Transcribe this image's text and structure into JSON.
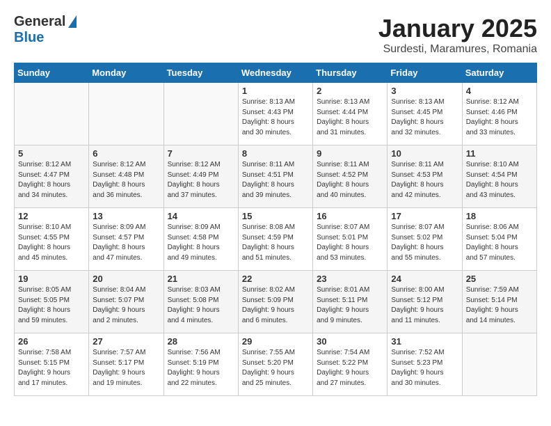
{
  "logo": {
    "general": "General",
    "blue": "Blue"
  },
  "title": "January 2025",
  "location": "Surdesti, Maramures, Romania",
  "days_of_week": [
    "Sunday",
    "Monday",
    "Tuesday",
    "Wednesday",
    "Thursday",
    "Friday",
    "Saturday"
  ],
  "weeks": [
    [
      {
        "day": "",
        "info": ""
      },
      {
        "day": "",
        "info": ""
      },
      {
        "day": "",
        "info": ""
      },
      {
        "day": "1",
        "info": "Sunrise: 8:13 AM\nSunset: 4:43 PM\nDaylight: 8 hours\nand 30 minutes."
      },
      {
        "day": "2",
        "info": "Sunrise: 8:13 AM\nSunset: 4:44 PM\nDaylight: 8 hours\nand 31 minutes."
      },
      {
        "day": "3",
        "info": "Sunrise: 8:13 AM\nSunset: 4:45 PM\nDaylight: 8 hours\nand 32 minutes."
      },
      {
        "day": "4",
        "info": "Sunrise: 8:12 AM\nSunset: 4:46 PM\nDaylight: 8 hours\nand 33 minutes."
      }
    ],
    [
      {
        "day": "5",
        "info": "Sunrise: 8:12 AM\nSunset: 4:47 PM\nDaylight: 8 hours\nand 34 minutes."
      },
      {
        "day": "6",
        "info": "Sunrise: 8:12 AM\nSunset: 4:48 PM\nDaylight: 8 hours\nand 36 minutes."
      },
      {
        "day": "7",
        "info": "Sunrise: 8:12 AM\nSunset: 4:49 PM\nDaylight: 8 hours\nand 37 minutes."
      },
      {
        "day": "8",
        "info": "Sunrise: 8:11 AM\nSunset: 4:51 PM\nDaylight: 8 hours\nand 39 minutes."
      },
      {
        "day": "9",
        "info": "Sunrise: 8:11 AM\nSunset: 4:52 PM\nDaylight: 8 hours\nand 40 minutes."
      },
      {
        "day": "10",
        "info": "Sunrise: 8:11 AM\nSunset: 4:53 PM\nDaylight: 8 hours\nand 42 minutes."
      },
      {
        "day": "11",
        "info": "Sunrise: 8:10 AM\nSunset: 4:54 PM\nDaylight: 8 hours\nand 43 minutes."
      }
    ],
    [
      {
        "day": "12",
        "info": "Sunrise: 8:10 AM\nSunset: 4:55 PM\nDaylight: 8 hours\nand 45 minutes."
      },
      {
        "day": "13",
        "info": "Sunrise: 8:09 AM\nSunset: 4:57 PM\nDaylight: 8 hours\nand 47 minutes."
      },
      {
        "day": "14",
        "info": "Sunrise: 8:09 AM\nSunset: 4:58 PM\nDaylight: 8 hours\nand 49 minutes."
      },
      {
        "day": "15",
        "info": "Sunrise: 8:08 AM\nSunset: 4:59 PM\nDaylight: 8 hours\nand 51 minutes."
      },
      {
        "day": "16",
        "info": "Sunrise: 8:07 AM\nSunset: 5:01 PM\nDaylight: 8 hours\nand 53 minutes."
      },
      {
        "day": "17",
        "info": "Sunrise: 8:07 AM\nSunset: 5:02 PM\nDaylight: 8 hours\nand 55 minutes."
      },
      {
        "day": "18",
        "info": "Sunrise: 8:06 AM\nSunset: 5:04 PM\nDaylight: 8 hours\nand 57 minutes."
      }
    ],
    [
      {
        "day": "19",
        "info": "Sunrise: 8:05 AM\nSunset: 5:05 PM\nDaylight: 8 hours\nand 59 minutes."
      },
      {
        "day": "20",
        "info": "Sunrise: 8:04 AM\nSunset: 5:07 PM\nDaylight: 9 hours\nand 2 minutes."
      },
      {
        "day": "21",
        "info": "Sunrise: 8:03 AM\nSunset: 5:08 PM\nDaylight: 9 hours\nand 4 minutes."
      },
      {
        "day": "22",
        "info": "Sunrise: 8:02 AM\nSunset: 5:09 PM\nDaylight: 9 hours\nand 6 minutes."
      },
      {
        "day": "23",
        "info": "Sunrise: 8:01 AM\nSunset: 5:11 PM\nDaylight: 9 hours\nand 9 minutes."
      },
      {
        "day": "24",
        "info": "Sunrise: 8:00 AM\nSunset: 5:12 PM\nDaylight: 9 hours\nand 11 minutes."
      },
      {
        "day": "25",
        "info": "Sunrise: 7:59 AM\nSunset: 5:14 PM\nDaylight: 9 hours\nand 14 minutes."
      }
    ],
    [
      {
        "day": "26",
        "info": "Sunrise: 7:58 AM\nSunset: 5:15 PM\nDaylight: 9 hours\nand 17 minutes."
      },
      {
        "day": "27",
        "info": "Sunrise: 7:57 AM\nSunset: 5:17 PM\nDaylight: 9 hours\nand 19 minutes."
      },
      {
        "day": "28",
        "info": "Sunrise: 7:56 AM\nSunset: 5:19 PM\nDaylight: 9 hours\nand 22 minutes."
      },
      {
        "day": "29",
        "info": "Sunrise: 7:55 AM\nSunset: 5:20 PM\nDaylight: 9 hours\nand 25 minutes."
      },
      {
        "day": "30",
        "info": "Sunrise: 7:54 AM\nSunset: 5:22 PM\nDaylight: 9 hours\nand 27 minutes."
      },
      {
        "day": "31",
        "info": "Sunrise: 7:52 AM\nSunset: 5:23 PM\nDaylight: 9 hours\nand 30 minutes."
      },
      {
        "day": "",
        "info": ""
      }
    ]
  ]
}
